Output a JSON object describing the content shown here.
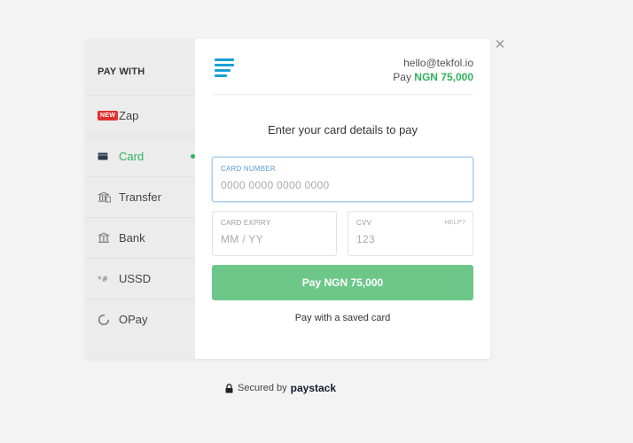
{
  "sidebar": {
    "title": "PAY WITH",
    "items": [
      {
        "label": "Zap",
        "badge": "NEW",
        "icon": "new-badge"
      },
      {
        "label": "Card",
        "icon": "card-icon",
        "active": true
      },
      {
        "label": "Transfer",
        "icon": "transfer-bank-icon"
      },
      {
        "label": "Bank",
        "icon": "bank-icon"
      },
      {
        "label": "USSD",
        "icon": "ussd-icon"
      },
      {
        "label": "OPay",
        "icon": "opay-icon"
      }
    ]
  },
  "header": {
    "email": "hello@tekfol.io",
    "pay_label": "Pay",
    "amount": "NGN 75,000"
  },
  "form": {
    "heading": "Enter your card details to pay",
    "card_number": {
      "label": "CARD NUMBER",
      "placeholder": "0000 0000 0000 0000"
    },
    "expiry": {
      "label": "CARD EXPIRY",
      "placeholder": "MM / YY"
    },
    "cvv": {
      "label": "CVV",
      "help": "HELP?",
      "placeholder": "123"
    },
    "pay_button": "Pay NGN 75,000",
    "saved_card": "Pay with a saved card"
  },
  "footer": {
    "secured_text": "Secured by",
    "brand": "paystack"
  },
  "colors": {
    "accent_green": "#2fb35d",
    "button_green": "#6cc789",
    "logo_blue": "#1b9fd6",
    "badge_red": "#e0312f"
  }
}
